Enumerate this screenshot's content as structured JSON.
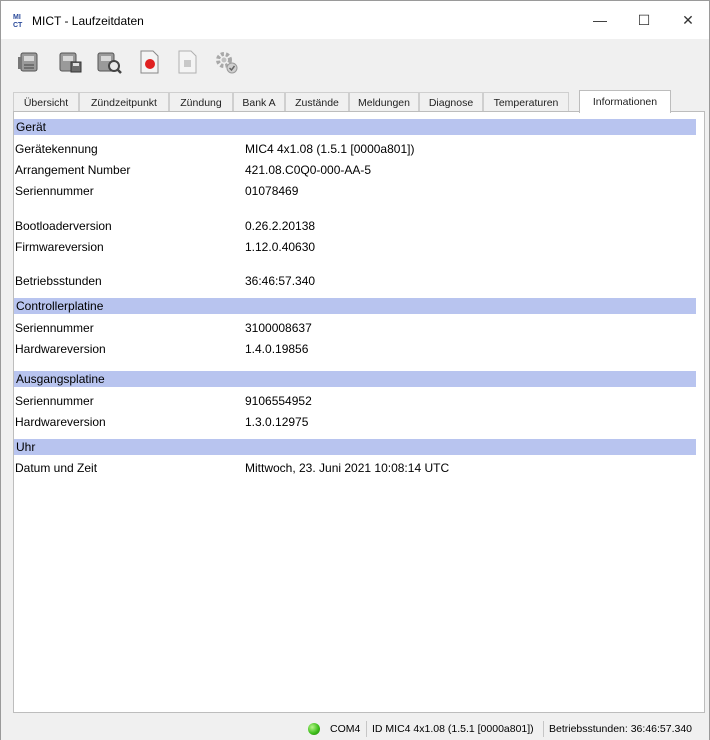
{
  "window": {
    "title": "MICT - Laufzeitdaten",
    "icon_text": "MI CT",
    "minimize_glyph": "—",
    "maximize_glyph": "☐",
    "close_glyph": "✕"
  },
  "toolbar": {
    "buttons": [
      {
        "icon": "device-read-icon"
      },
      {
        "icon": "device-save-icon"
      },
      {
        "icon": "device-search-icon"
      },
      {
        "icon": "record-icon"
      },
      {
        "icon": "document-icon"
      },
      {
        "icon": "settings-check-icon"
      }
    ]
  },
  "tabs": [
    {
      "label": "Übersicht"
    },
    {
      "label": "Zündzeitpunkt"
    },
    {
      "label": "Zündung"
    },
    {
      "label": "Bank A"
    },
    {
      "label": "Zustände"
    },
    {
      "label": "Meldungen"
    },
    {
      "label": "Diagnose"
    },
    {
      "label": "Temperaturen"
    },
    {
      "label": "Informationen",
      "active": true
    }
  ],
  "info": {
    "geraet": {
      "heading": "Gerät",
      "kennung_label": "Gerätekennung",
      "kennung_value": "MIC4 4x1.08 (1.5.1 [0000a801])",
      "arrangement_label": "Arrangement Number",
      "arrangement_value": "421.08.C0Q0-000-AA-5",
      "serien_label": "Seriennummer",
      "serien_value": "01078469",
      "bootloader_label": "Bootloaderversion",
      "bootloader_value": "0.26.2.20138",
      "firmware_label": "Firmwareversion",
      "firmware_value": "1.12.0.40630",
      "stunden_label": "Betriebsstunden",
      "stunden_value": "36:46:57.340"
    },
    "controller": {
      "heading": "Controllerplatine",
      "serien_label": "Seriennummer",
      "serien_value": "3100008637",
      "hw_label": "Hardwareversion",
      "hw_value": "1.4.0.19856"
    },
    "ausgang": {
      "heading": "Ausgangsplatine",
      "serien_label": "Seriennummer",
      "serien_value": "9106554952",
      "hw_label": "Hardwareversion",
      "hw_value": "1.3.0.12975"
    },
    "uhr": {
      "heading": "Uhr",
      "datum_label": "Datum und Zeit",
      "datum_value": "Mittwoch, 23. Juni 2021 10:08:14 UTC"
    }
  },
  "statusbar": {
    "port": "COM4",
    "id": "ID MIC4 4x1.08 (1.5.1 [0000a801])",
    "hours": "Betriebsstunden: 36:46:57.340",
    "connection_color": "#3fbf1c"
  }
}
